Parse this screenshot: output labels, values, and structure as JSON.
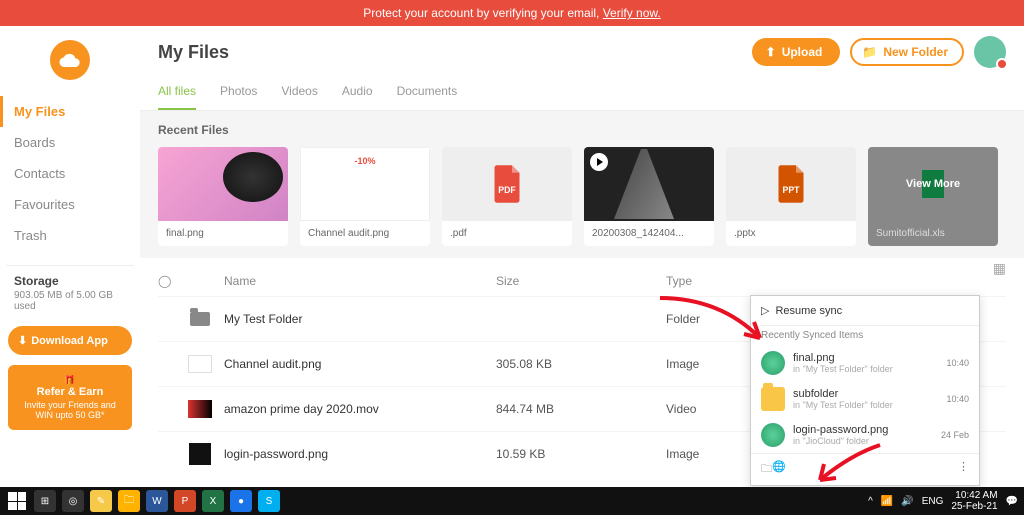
{
  "banner": {
    "text": "Protect your account by verifying your email, ",
    "link": "Verify now."
  },
  "sidebar": {
    "nav": [
      "My Files",
      "Boards",
      "Contacts",
      "Favourites",
      "Trash"
    ],
    "storage_title": "Storage",
    "storage_detail": "903.05 MB of 5.00 GB used",
    "download": "Download App",
    "refer_title": "Refer & Earn",
    "refer_sub": "Invite your Friends and WIN upto 50 GB*"
  },
  "header": {
    "title": "My Files",
    "upload": "Upload",
    "new_folder": "New Folder"
  },
  "tabs": [
    "All files",
    "Photos",
    "Videos",
    "Audio",
    "Documents"
  ],
  "recent": {
    "title": "Recent Files",
    "items": [
      "final.png",
      "Channel audit.png",
      ".pdf",
      "20200308_142404...",
      ".pptx",
      "Sumitofficial.xls"
    ],
    "more_label": "View More",
    "badge_10": "-10%"
  },
  "list": {
    "headers": {
      "name": "Name",
      "size": "Size",
      "type": "Type"
    },
    "rows": [
      {
        "name": "My Test Folder",
        "size": "",
        "type": "Folder"
      },
      {
        "name": "Channel audit.png",
        "size": "305.08 KB",
        "type": "Image"
      },
      {
        "name": "amazon prime day 2020.mov",
        "size": "844.74 MB",
        "type": "Video"
      },
      {
        "name": "login-password.png",
        "size": "10.59 KB",
        "type": "Image"
      }
    ]
  },
  "sync": {
    "resume": "Resume sync",
    "recently": "Recently Synced Items",
    "items": [
      {
        "name": "final.png",
        "path": "in \"My Test Folder\" folder",
        "time": "10:40"
      },
      {
        "name": "subfolder",
        "path": "in \"My Test Folder\" folder",
        "time": "10:40"
      },
      {
        "name": "login-password.png",
        "path": "in \"JioCloud\" folder",
        "time": "24 Feb"
      }
    ]
  },
  "taskbar": {
    "time": "10:42 AM",
    "date": "25-Feb-21",
    "lang": "ENG"
  }
}
